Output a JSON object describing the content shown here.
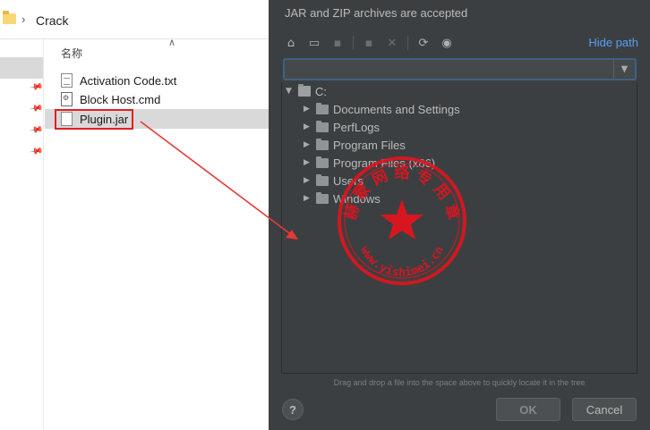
{
  "explorer": {
    "path_separator": "›",
    "path": "Crack",
    "column_header": "名称",
    "files": [
      {
        "name": "Activation Code.txt",
        "icon": "text-file-icon"
      },
      {
        "name": "Block Host.cmd",
        "icon": "cmd-file-icon"
      },
      {
        "name": "Plugin.jar",
        "icon": "jar-file-icon",
        "selected": true
      }
    ]
  },
  "dialog": {
    "title": "JAR and ZIP archives are accepted",
    "hide_path": "Hide path",
    "path_value": "",
    "tree": {
      "root": "C:",
      "children": [
        "Documents and Settings",
        "PerfLogs",
        "Program Files",
        "Program Files (x86)",
        "Users",
        "Windows"
      ]
    },
    "hint": "Drag and drop a file into the space above to quickly locate it in the tree",
    "help_label": "?",
    "ok_label": "OK",
    "cancel_label": "Cancel"
  },
  "watermark": {
    "top_text": "赫 蒙 网 络 专 用 章",
    "bottom_text": "www.yishimei.cn"
  },
  "colors": {
    "dialog_bg": "#3c3f41",
    "link": "#589df6",
    "highlight": "#e02020"
  }
}
